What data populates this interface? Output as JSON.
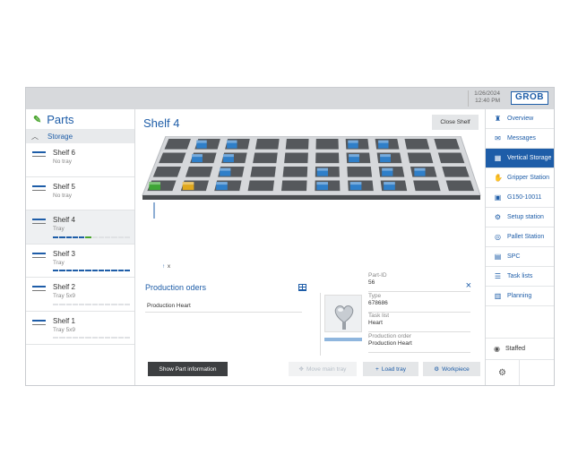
{
  "header": {
    "date": "1/26/2024",
    "time": "12:40 PM",
    "logo": "GROB"
  },
  "left": {
    "title": "Parts",
    "section": "Storage",
    "shelves": [
      {
        "name": "Shelf 6",
        "status": "No tray"
      },
      {
        "name": "Shelf 5",
        "status": "No tray"
      },
      {
        "name": "Shelf 4",
        "status": "Tray"
      },
      {
        "name": "Shelf 3",
        "status": "Tray"
      },
      {
        "name": "Shelf 2",
        "status": "Tray 5x9"
      },
      {
        "name": "Shelf 1",
        "status": "Tray 5x9"
      }
    ]
  },
  "center": {
    "title": "Shelf 4",
    "close_shelf": "Close Shelf",
    "axis_x": "x",
    "production_title": "Production oders",
    "production_item": "Production Heart",
    "close_icon": "×",
    "details": [
      {
        "label": "Part-ID",
        "value": "56"
      },
      {
        "label": "Type",
        "value": "678686"
      },
      {
        "label": "Task list",
        "value": "Heart"
      },
      {
        "label": "Production order",
        "value": "Production Heart"
      }
    ],
    "show_part": "Show Part information",
    "move_tray": "Move main tray",
    "load_tray": "Load tray",
    "workpiece": "Workpiece"
  },
  "nav": {
    "items": [
      {
        "label": "Overview",
        "icon": "robot-icon"
      },
      {
        "label": "Messages",
        "icon": "messages-icon"
      },
      {
        "label": "Vertical Storage",
        "icon": "grid-icon"
      },
      {
        "label": "Gripper Station",
        "icon": "gripper-icon"
      },
      {
        "label": "G150-10011",
        "icon": "machine-icon"
      },
      {
        "label": "Setup station",
        "icon": "setup-icon"
      },
      {
        "label": "Pallet Station",
        "icon": "pallet-icon"
      },
      {
        "label": "SPC",
        "icon": "spc-icon"
      },
      {
        "label": "Task lists",
        "icon": "tasklist-icon"
      },
      {
        "label": "Planning",
        "icon": "planning-icon"
      }
    ],
    "staffed": "Staffed"
  },
  "colors": {
    "accent": "#1e5da8",
    "green": "#4aa52e",
    "yellow": "#e0a81e"
  }
}
